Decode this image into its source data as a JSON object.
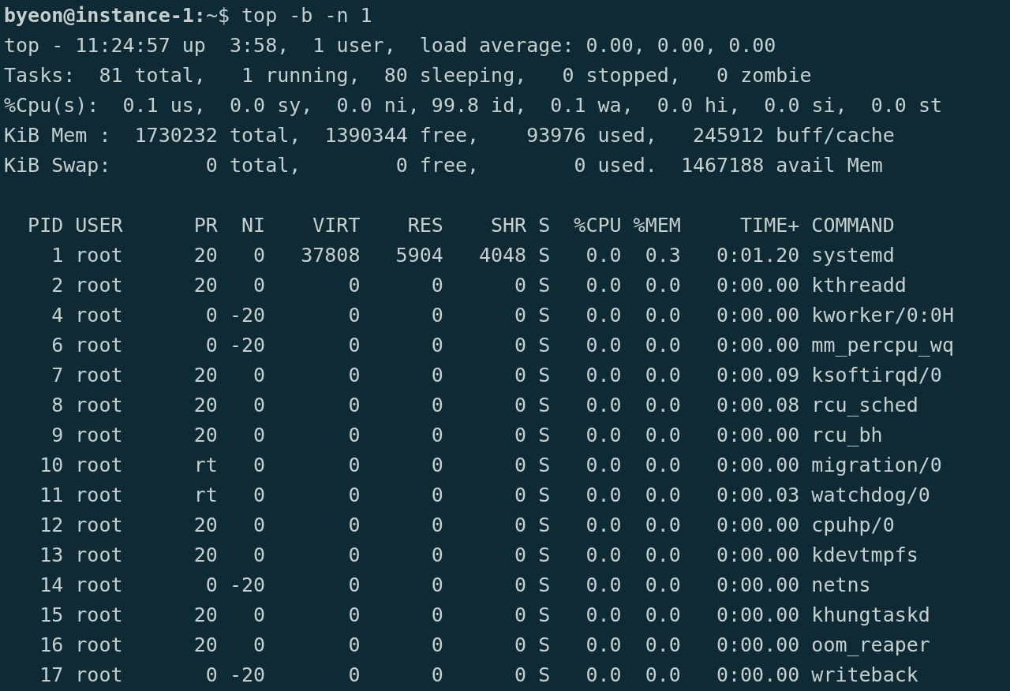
{
  "prompt_line": "**byeon@instance-1:**~$ top -b -n 1",
  "summary_lines": [
    "top - 11:24:57 up  3:58,  1 user,  load average: 0.00, 0.00, 0.00",
    "Tasks:  81 total,   1 running,  80 sleeping,   0 stopped,   0 zombie",
    "%Cpu(s):  0.1 us,  0.0 sy,  0.0 ni, 99.8 id,  0.1 wa,  0.0 hi,  0.0 si,  0.0 st",
    "KiB Mem :  1730232 total,  1390344 free,    93976 used,   245912 buff/cache",
    "KiB Swap:        0 total,        0 free,        0 used.  1467188 avail Mem"
  ],
  "process_table": {
    "columns": [
      "PID",
      "USER",
      "PR",
      "NI",
      "VIRT",
      "RES",
      "SHR",
      "S",
      "%CPU",
      "%MEM",
      "TIME+",
      "COMMAND"
    ],
    "rows": [
      [
        "1",
        "root",
        "20",
        "0",
        "37808",
        "5904",
        "4048",
        "S",
        "0.0",
        "0.3",
        "0:01.20",
        "systemd"
      ],
      [
        "2",
        "root",
        "20",
        "0",
        "0",
        "0",
        "0",
        "S",
        "0.0",
        "0.0",
        "0:00.00",
        "kthreadd"
      ],
      [
        "4",
        "root",
        "0",
        "-20",
        "0",
        "0",
        "0",
        "S",
        "0.0",
        "0.0",
        "0:00.00",
        "kworker/0:0H"
      ],
      [
        "6",
        "root",
        "0",
        "-20",
        "0",
        "0",
        "0",
        "S",
        "0.0",
        "0.0",
        "0:00.00",
        "mm_percpu_wq"
      ],
      [
        "7",
        "root",
        "20",
        "0",
        "0",
        "0",
        "0",
        "S",
        "0.0",
        "0.0",
        "0:00.09",
        "ksoftirqd/0"
      ],
      [
        "8",
        "root",
        "20",
        "0",
        "0",
        "0",
        "0",
        "S",
        "0.0",
        "0.0",
        "0:00.08",
        "rcu_sched"
      ],
      [
        "9",
        "root",
        "20",
        "0",
        "0",
        "0",
        "0",
        "S",
        "0.0",
        "0.0",
        "0:00.00",
        "rcu_bh"
      ],
      [
        "10",
        "root",
        "rt",
        "0",
        "0",
        "0",
        "0",
        "S",
        "0.0",
        "0.0",
        "0:00.00",
        "migration/0"
      ],
      [
        "11",
        "root",
        "rt",
        "0",
        "0",
        "0",
        "0",
        "S",
        "0.0",
        "0.0",
        "0:00.03",
        "watchdog/0"
      ],
      [
        "12",
        "root",
        "20",
        "0",
        "0",
        "0",
        "0",
        "S",
        "0.0",
        "0.0",
        "0:00.00",
        "cpuhp/0"
      ],
      [
        "13",
        "root",
        "20",
        "0",
        "0",
        "0",
        "0",
        "S",
        "0.0",
        "0.0",
        "0:00.00",
        "kdevtmpfs"
      ],
      [
        "14",
        "root",
        "0",
        "-20",
        "0",
        "0",
        "0",
        "S",
        "0.0",
        "0.0",
        "0:00.00",
        "netns"
      ],
      [
        "15",
        "root",
        "20",
        "0",
        "0",
        "0",
        "0",
        "S",
        "0.0",
        "0.0",
        "0:00.00",
        "khungtaskd"
      ],
      [
        "16",
        "root",
        "20",
        "0",
        "0",
        "0",
        "0",
        "S",
        "0.0",
        "0.0",
        "0:00.00",
        "oom_reaper"
      ],
      [
        "17",
        "root",
        "0",
        "-20",
        "0",
        "0",
        "0",
        "S",
        "0.0",
        "0.0",
        "0:00.00",
        "writeback"
      ]
    ]
  }
}
